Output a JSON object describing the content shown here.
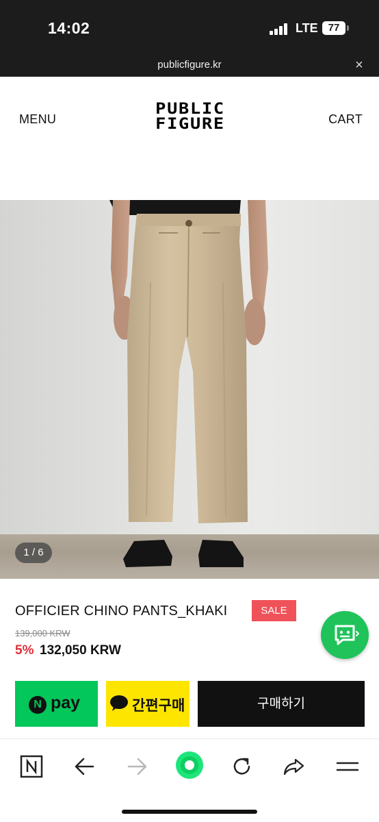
{
  "status_bar": {
    "time": "14:02",
    "network": "LTE",
    "battery": "77"
  },
  "url_bar": {
    "url": "publicfigure.kr",
    "close_symbol": "×"
  },
  "header": {
    "menu_label": "MENU",
    "cart_label": "CART",
    "logo_line1": "PUBLIC",
    "logo_line2": "FIGURE"
  },
  "gallery": {
    "counter": "1 / 6"
  },
  "product": {
    "title": "OFFICIER CHINO PANTS_KHAKI",
    "sale_badge": "SALE",
    "original_price": "139,000 KRW",
    "discount": "5%",
    "price": "132,050 KRW"
  },
  "purchase": {
    "npay_badge": "N",
    "npay_label": "pay",
    "kakao_label": "간편구매",
    "buy_label": "구매하기"
  },
  "colors": {
    "npay_green": "#03c75a",
    "kakao_yellow": "#fee500",
    "sale_red": "#f0525a",
    "discount_red": "#e0303a",
    "chat_green": "#1fc35a"
  },
  "icons": {
    "chat_fab": "chat-bubble-icon",
    "toolbar": [
      "naver-n-icon",
      "back-arrow-icon",
      "forward-arrow-icon",
      "green-dot-icon",
      "reload-icon",
      "share-icon",
      "menu-icon"
    ]
  }
}
